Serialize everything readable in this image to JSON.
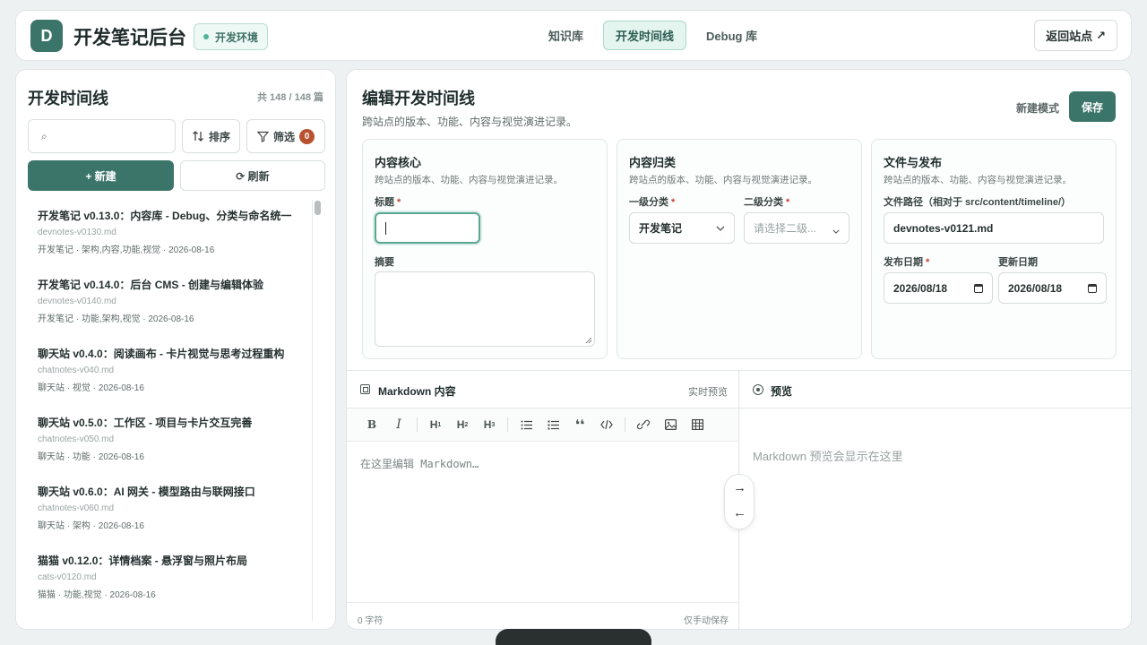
{
  "header": {
    "logo_letter": "D",
    "app_title": "开发笔记后台",
    "env_badge": "开发环境",
    "nav_tabs": [
      {
        "label": "知识库",
        "active": false
      },
      {
        "label": "开发时间线",
        "active": true
      },
      {
        "label": "Debug 库",
        "active": false
      }
    ],
    "back_label": "返回站点",
    "back_icon": "↗"
  },
  "sidebar": {
    "title": "开发时间线",
    "count": "共 148 / 148 篇",
    "search_icon": "⌕",
    "search_placeholder": "",
    "sort_label": "排序",
    "filter_label": "筛选",
    "filter_count": "0",
    "new_label": "+ 新建",
    "refresh_label": "⟳ 刷新",
    "items": [
      {
        "title": "开发笔记 v0.13.0：内容库 - Debug、分类与命名统一",
        "file": "devnotes-v0130.md",
        "meta": "开发笔记 · 架构,内容,功能,视觉 · 2026-08-16"
      },
      {
        "title": "开发笔记 v0.14.0：后台 CMS - 创建与编辑体验",
        "file": "devnotes-v0140.md",
        "meta": "开发笔记 · 功能,架构,视觉 · 2026-08-16"
      },
      {
        "title": "聊天站 v0.4.0：阅读画布 - 卡片视觉与思考过程重构",
        "file": "chatnotes-v040.md",
        "meta": "聊天站 · 视觉 · 2026-08-16"
      },
      {
        "title": "聊天站 v0.5.0：工作区 - 项目与卡片交互完善",
        "file": "chatnotes-v050.md",
        "meta": "聊天站 · 功能 · 2026-08-16"
      },
      {
        "title": "聊天站 v0.6.0：AI 网关 - 模型路由与联网接口",
        "file": "chatnotes-v060.md",
        "meta": "聊天站 · 架构 · 2026-08-16"
      },
      {
        "title": "猫猫 v0.12.0：详情档案 - 悬浮窗与照片布局",
        "file": "cats-v0120.md",
        "meta": "猫猫 · 功能,视觉 · 2026-08-16"
      }
    ]
  },
  "editor": {
    "title": "编辑开发时间线",
    "subtitle": "跨站点的版本、功能、内容与视觉演进记录。",
    "mode_label": "新建模式",
    "save_label": "保存",
    "card_core": {
      "title": "内容核心",
      "subtitle": "跨站点的版本、功能、内容与视觉演进记录。",
      "title_label": "标题",
      "title_value": "",
      "summary_label": "摘要",
      "summary_value": ""
    },
    "card_category": {
      "title": "内容归类",
      "subtitle": "跨站点的版本、功能、内容与视觉演进记录。",
      "level1_label": "一级分类",
      "level1_value": "开发笔记",
      "level2_label": "二级分类",
      "level2_placeholder": "请选择二级..."
    },
    "card_publish": {
      "title": "文件与发布",
      "subtitle": "跨站点的版本、功能、内容与视觉演进记录。",
      "path_label": "文件路径（相对于 src/content/timeline/）",
      "path_value": "devnotes-v0121.md",
      "publish_label": "发布日期",
      "publish_value": "2026/08/18",
      "update_label": "更新日期",
      "update_value": "2026/08/18"
    },
    "required_mark": "*"
  },
  "markdown": {
    "title": "Markdown 内容",
    "live_label": "实时预览",
    "placeholder": "在这里编辑 Markdown…",
    "char_count": "0 字符",
    "save_hint": "仅手动保存",
    "toolbar": [
      "B",
      "I",
      "H1",
      "H2",
      "H3",
      "ul",
      "ol",
      "quote",
      "code",
      "link",
      "image",
      "table"
    ]
  },
  "preview": {
    "title": "预览",
    "empty_text": "Markdown 预览会显示在这里"
  },
  "colors": {
    "accent": "#3b7569",
    "badge": "#b8512f",
    "background": "#eef1f1"
  }
}
